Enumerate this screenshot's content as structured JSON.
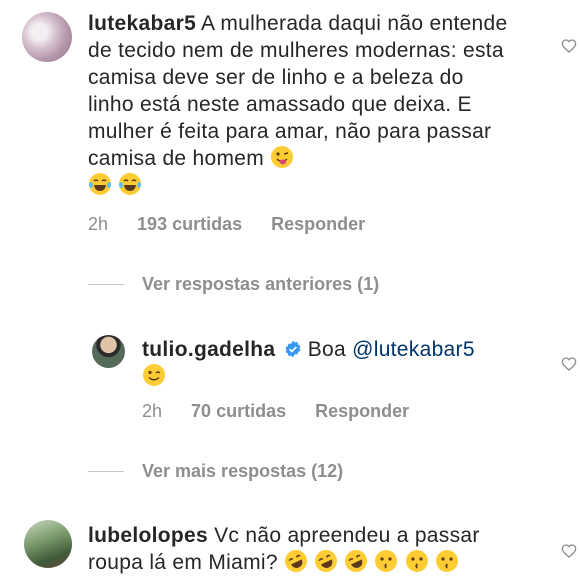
{
  "comments": [
    {
      "username": "lutekabar5",
      "text": "A mulherada daqui não entende de tecido nem de mulheres modernas: esta camisa deve ser de linho e a beleza do linho está neste amassado que deixa. E mulher é feita para amar, não para passar camisa de homem",
      "emojis": [
        "winking-tongue",
        "tears-of-joy",
        "tears-of-joy"
      ],
      "time": "2h",
      "likes": "193 curtidas",
      "reply_label": "Responder",
      "view_previous": "Ver respostas anteriores (1)"
    },
    {
      "username": "tulio.gadelha",
      "verified": true,
      "text": "Boa",
      "mention": "@lutekabar5",
      "emojis": [
        "wink"
      ],
      "time": "2h",
      "likes": "70 curtidas",
      "reply_label": "Responder",
      "view_more": "Ver mais respostas (12)"
    },
    {
      "username": "lubelolopes",
      "text": "Vc não apreendeu a passar roupa lá em Miami?",
      "emojis": [
        "rofl",
        "rofl",
        "rofl",
        "kissing",
        "kissing",
        "kissing"
      ]
    }
  ],
  "icons": {
    "like": "heart-outline-icon",
    "verified": "verified-badge-icon"
  },
  "colors": {
    "mention": "#003569",
    "meta": "#8e8e8e",
    "verified": "#3897f0"
  }
}
